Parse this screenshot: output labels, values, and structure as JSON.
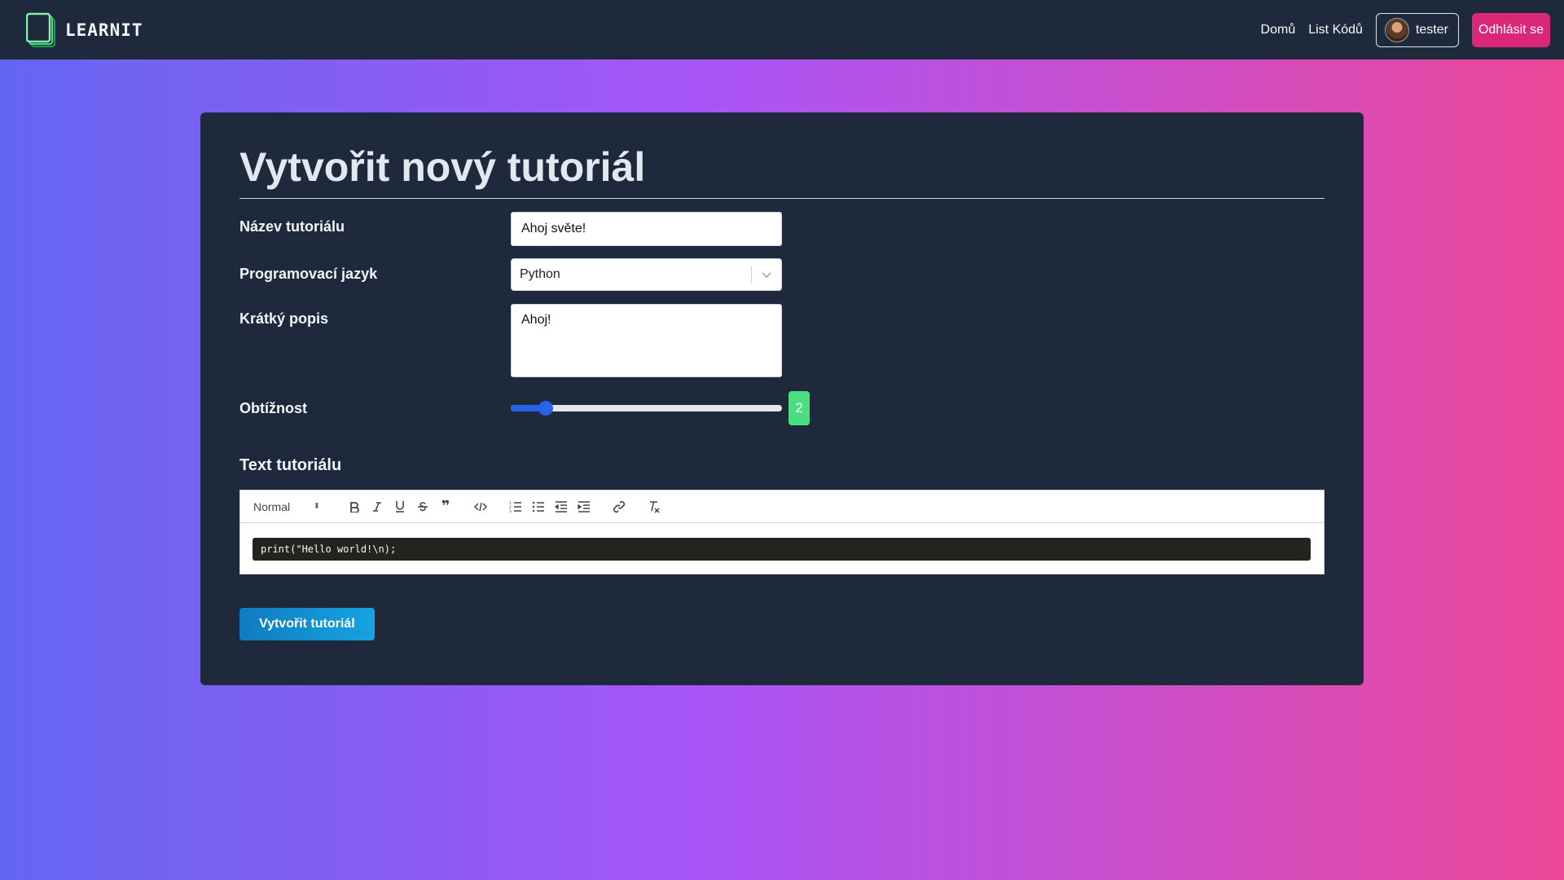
{
  "brand": {
    "name": "LEARNIT",
    "logo_icon": "book-stack-icon"
  },
  "nav": {
    "home": "Domů",
    "code_list": "List Kódů",
    "username": "tester",
    "logout": "Odhlásit se"
  },
  "colors": {
    "navbar_bg": "#1e293b",
    "card_bg": "#1e293b",
    "logout_bg": "#db2777",
    "slider_accent": "#2563eb",
    "difficulty_badge": "#4ade80",
    "submit_bg": "#0e7cc0"
  },
  "form": {
    "title": "Vytvořit nový tutoriál",
    "name_label": "Název tutoriálu",
    "name_value": "Ahoj světe!",
    "language_label": "Programovací jazyk",
    "language_value": "Python",
    "description_label": "Krátký popis",
    "description_value": "Ahoj!",
    "difficulty_label": "Obtížnost",
    "difficulty_value": "2",
    "difficulty_fraction": 0.13,
    "text_label": "Text tutoriálu",
    "submit": "Vytvořit tutoriál"
  },
  "editor": {
    "heading_select": "Normal",
    "toolbar_icons": [
      "bold-icon",
      "italic-icon",
      "underline-icon",
      "strikethrough-icon",
      "blockquote-icon",
      "code-icon",
      "ordered-list-icon",
      "bullet-list-icon",
      "outdent-icon",
      "indent-icon",
      "link-icon",
      "clear-format-icon"
    ],
    "code": "print(\"Hello world!\\n);"
  }
}
